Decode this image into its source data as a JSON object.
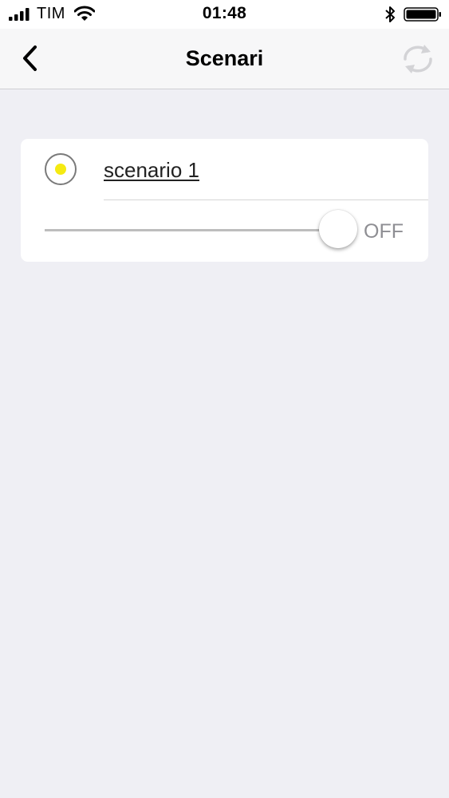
{
  "status_bar": {
    "carrier": "TIM",
    "time": "01:48",
    "icons": [
      "signal-icon",
      "wifi-icon",
      "bluetooth-icon",
      "battery-icon"
    ]
  },
  "nav": {
    "title": "Scenari",
    "back_icon": "chevron-left-icon",
    "refresh_icon": "refresh-icon",
    "refresh_enabled": false
  },
  "scenarios": [
    {
      "name": "scenario 1",
      "selected": true,
      "indicator_color": "#f5ea12",
      "slider_level": 1.0,
      "value_label": "OFF"
    }
  ],
  "colors": {
    "background": "#efeff4",
    "card": "#ffffff",
    "muted_text": "#8e8e93"
  }
}
